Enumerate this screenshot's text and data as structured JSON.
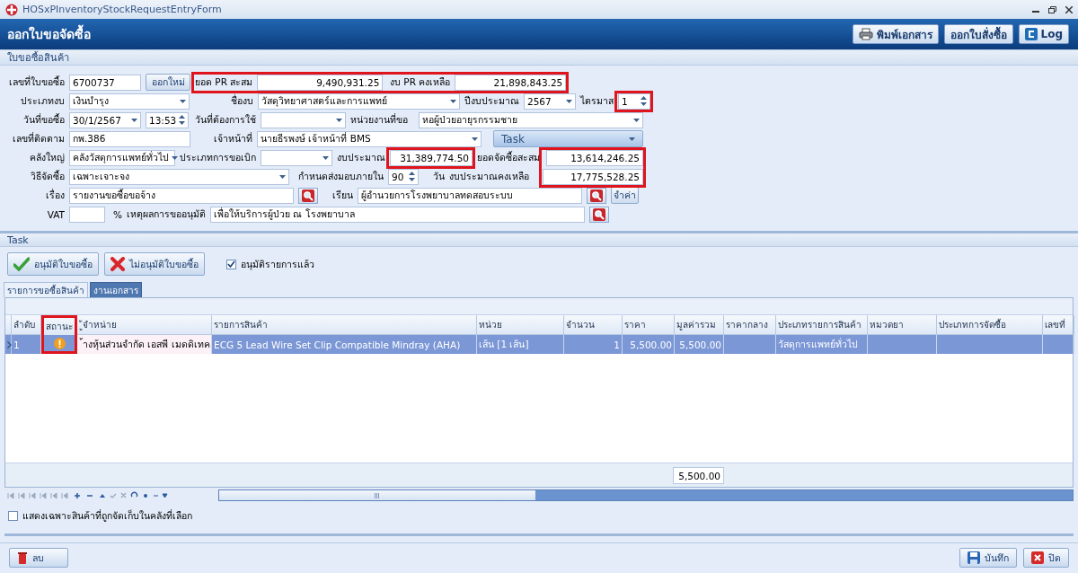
{
  "window": {
    "title": "HOSxPInventoryStockRequestEntryForm"
  },
  "header": {
    "title": "ออกใบขอจัดซื้อ",
    "buttons": [
      {
        "label": "พิมพ์เอกสาร"
      },
      {
        "label": "ออกใบสั่งซื้อ"
      },
      {
        "label": "Log"
      }
    ]
  },
  "form": {
    "section": "ใบขอซื้อสินค้า",
    "rows": [
      {
        "items": [
          {
            "kind": "label",
            "text": "เลขที่ใบขอซื้อ"
          },
          {
            "kind": "field",
            "value": "6700737"
          },
          {
            "kind": "button",
            "text": "ออกใหม่"
          },
          {
            "kind": "label",
            "text": "ยอด PR สะสม",
            "highlighted": true
          },
          {
            "kind": "number",
            "value": "9,490,931.25",
            "highlighted": true
          },
          {
            "kind": "label",
            "text": "งบ PR คงเหลือ",
            "highlighted": true
          },
          {
            "kind": "number",
            "value": "21,898,843.25",
            "highlighted": true
          }
        ]
      },
      {
        "items": [
          {
            "kind": "label",
            "text": "ประเภทงบ"
          },
          {
            "kind": "combo",
            "value": "เงินบำรุง"
          },
          {
            "kind": "label",
            "text": "ชื่องบ"
          },
          {
            "kind": "combo",
            "value": "วัสดุวิทยาศาสตร์และการแพทย์"
          },
          {
            "kind": "label",
            "text": "ปีงบประมาณ"
          },
          {
            "kind": "combo",
            "value": "2567"
          },
          {
            "kind": "label",
            "text": "ไตรมาส"
          },
          {
            "kind": "spin",
            "value": "1",
            "highlighted": true
          }
        ]
      },
      {
        "items": [
          {
            "kind": "label",
            "text": "วันที่ขอซื้อ"
          },
          {
            "kind": "combo",
            "value": "30/1/2567"
          },
          {
            "kind": "spin",
            "value": "13:53"
          },
          {
            "kind": "label",
            "text": "วันที่ต้องการใช้"
          },
          {
            "kind": "combo"
          },
          {
            "kind": "label",
            "text": "หน่วยงานที่ขอ"
          },
          {
            "kind": "combo",
            "value": "หอผู้ป่วยอายุรกรรมชาย"
          }
        ]
      },
      {
        "items": [
          {
            "kind": "label",
            "text": "เลขที่ติดตาม"
          },
          {
            "kind": "field",
            "value": "กพ.386"
          },
          {
            "kind": "label",
            "text": "เจ้าหน้าที่"
          },
          {
            "kind": "combo",
            "value": "นายธีรพงษ์ เจ้าหน้าที่ BMS"
          },
          {
            "kind": "task",
            "text": "Task"
          }
        ]
      },
      {
        "items": [
          {
            "kind": "label",
            "text": "คลังใหญ่"
          },
          {
            "kind": "combo",
            "value": "คลังวัสดุการแพทย์ทั่วไป"
          },
          {
            "kind": "label",
            "text": "ประเภทการขอเบิก"
          },
          {
            "kind": "combo"
          },
          {
            "kind": "label",
            "text": "งบประมาณ"
          },
          {
            "kind": "number",
            "value": "31,389,774.50",
            "highlighted": true
          },
          {
            "kind": "label",
            "text": "ยอดจัดซื้อสะสม"
          },
          {
            "kind": "number",
            "value": "13,614,246.25",
            "highlighted": true
          }
        ]
      },
      {
        "items": [
          {
            "kind": "label",
            "text": "วิธีจัดซื้อ"
          },
          {
            "kind": "combo",
            "value": "เฉพาะเจาะจง"
          },
          {
            "kind": "label",
            "text": "กำหนดส่งมอบภายใน"
          },
          {
            "kind": "spin",
            "value": "90"
          },
          {
            "kind": "label",
            "text": "วัน"
          },
          {
            "kind": "label",
            "text": "งบประมาณคงเหลือ"
          },
          {
            "kind": "number",
            "value": "17,775,528.25",
            "highlighted": true
          }
        ]
      },
      {
        "items": [
          {
            "kind": "label",
            "text": "เรื่อง"
          },
          {
            "kind": "field",
            "value": "รายงานขอซื้อขอจ้าง"
          },
          {
            "kind": "search"
          },
          {
            "kind": "label",
            "text": "เรียน"
          },
          {
            "kind": "field",
            "value": "ผู้อำนวยการโรงพยาบาลทดสอบระบบ"
          },
          {
            "kind": "search"
          },
          {
            "kind": "button",
            "text": "จำค่า"
          }
        ]
      },
      {
        "items": [
          {
            "kind": "label",
            "text": "VAT"
          },
          {
            "kind": "field"
          },
          {
            "kind": "label",
            "text": "%"
          },
          {
            "kind": "label",
            "text": "เหตุผลการขออนุมัติ"
          },
          {
            "kind": "field",
            "value": "เพื่อให้บริการผู้ป่วย ณ โรงพยาบาล"
          },
          {
            "kind": "search"
          }
        ]
      }
    ]
  },
  "task": {
    "section": "Task",
    "buttons": [
      {
        "label": "อนุมัติใบขอซื้อ"
      },
      {
        "label": "ไม่อนุมัติใบขอซื้อ"
      }
    ],
    "checkbox": {
      "label": "อนุมัติรายการแล้ว",
      "checked": true
    },
    "tabs": [
      {
        "label": "รายการขอซื้อสินค้า",
        "selected": false
      },
      {
        "label": "งานเอกสาร",
        "selected": true
      }
    ]
  },
  "grid": {
    "columns": [
      {
        "label": "ลำดับ",
        "kind": "text"
      },
      {
        "label": "สถานะ",
        "kind": "status",
        "highlighted": true
      },
      {
        "label": "ู้จำหน่าย",
        "kind": "text"
      },
      {
        "label": "รายการสินค้า",
        "kind": "text"
      },
      {
        "label": "หน่วย",
        "kind": "text"
      },
      {
        "label": "จำนวน",
        "kind": "number"
      },
      {
        "label": "ราคา",
        "kind": "number"
      },
      {
        "label": "มูลค่ารวม",
        "kind": "number"
      },
      {
        "label": "ราคากลาง",
        "kind": "number"
      },
      {
        "label": "ประเภทรายการสินค้า",
        "kind": "text"
      },
      {
        "label": "หมวดยา",
        "kind": "text"
      },
      {
        "label": "ประเภทการจัดซื้อ",
        "kind": "text"
      },
      {
        "label": "เลขที่",
        "kind": "text"
      }
    ],
    "rows": [
      {
        "selected": true,
        "kind": "warning",
        "cells": [
          "1",
          null,
          "้างหุ้นส่วนจำกัด เอสพี เมดดิเทค",
          "ECG 5 Lead Wire Set Clip Compatible Mindray (AHA)",
          "เส้น [1 เส้น]",
          "1",
          "5,500.00",
          "5,500.00",
          null,
          "วัสดุการแพทย์ทั่วไป",
          null,
          null,
          null
        ]
      }
    ],
    "total": "5,500.00",
    "filter": {
      "label": "แสดงเฉพาะสินค้าที่ถูกจัดเก็บในคลังที่เลือก",
      "checked": false
    }
  },
  "footer": {
    "buttons": [
      {
        "label": "ลบ"
      },
      {
        "label": "บันทึก"
      },
      {
        "label": "ปิด"
      }
    ]
  }
}
